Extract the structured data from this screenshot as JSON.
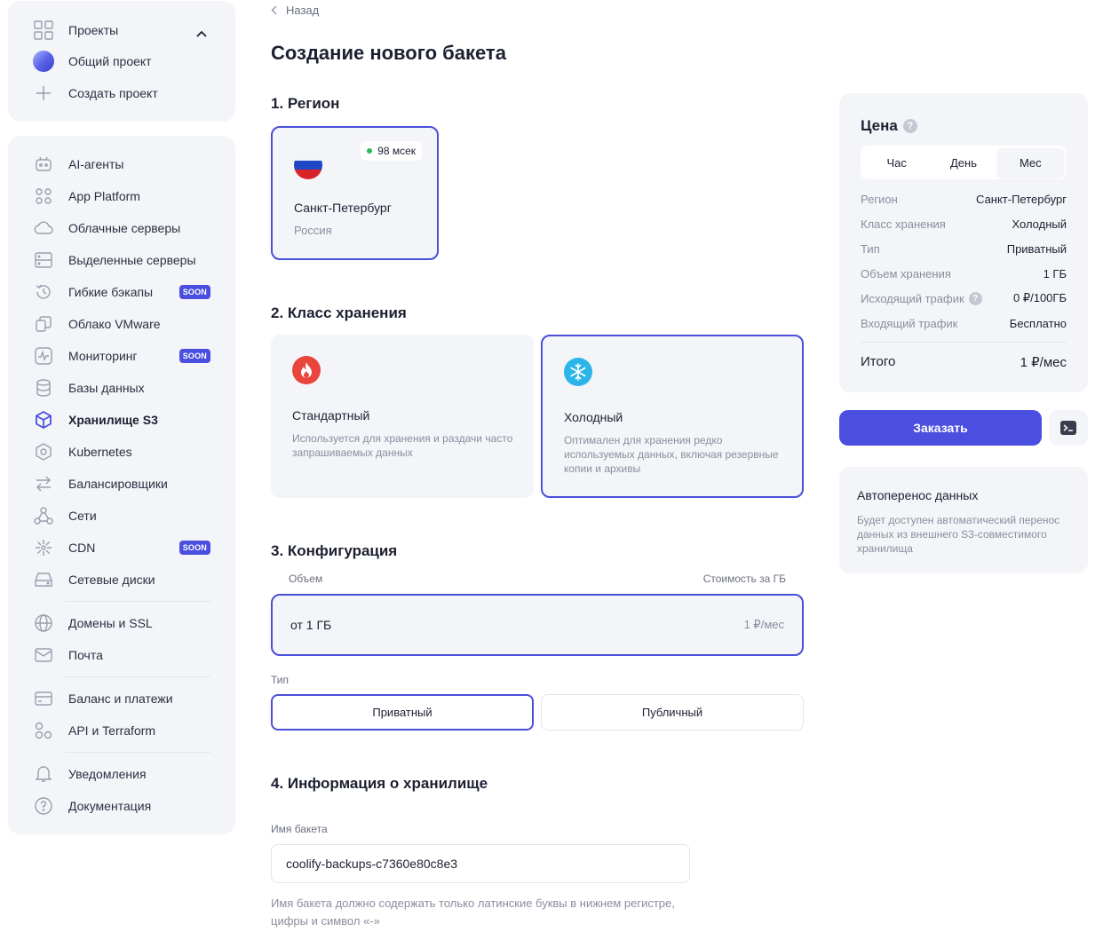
{
  "sidebar": {
    "projects": [
      {
        "label": "Проекты",
        "icon": "grid-icon"
      },
      {
        "label": "Общий проект",
        "icon": "project-avatar-icon"
      },
      {
        "label": "Создать проект",
        "icon": "plus-icon"
      }
    ],
    "items": [
      {
        "label": "AI-агенты",
        "icon": "robot-icon"
      },
      {
        "label": "App Platform",
        "icon": "apps-icon"
      },
      {
        "label": "Облачные серверы",
        "icon": "cloud-icon"
      },
      {
        "label": "Выделенные серверы",
        "icon": "server-icon"
      },
      {
        "label": "Гибкие бэкапы",
        "icon": "backup-icon",
        "badge": "SOON"
      },
      {
        "label": "Облако VMware",
        "icon": "vmware-icon"
      },
      {
        "label": "Мониторинг",
        "icon": "monitoring-icon",
        "badge": "SOON"
      },
      {
        "label": "Базы данных",
        "icon": "database-icon"
      },
      {
        "label": "Хранилище S3",
        "icon": "storage-cube-icon",
        "active": true
      },
      {
        "label": "Kubernetes",
        "icon": "kubernetes-icon"
      },
      {
        "label": "Балансировщики",
        "icon": "balancer-icon"
      },
      {
        "label": "Сети",
        "icon": "network-icon"
      },
      {
        "label": "CDN",
        "icon": "cdn-icon",
        "badge": "SOON"
      },
      {
        "label": "Сетевые диски",
        "icon": "disk-icon"
      },
      {
        "label": "Домены и SSL",
        "icon": "globe-icon"
      },
      {
        "label": "Почта",
        "icon": "mail-icon"
      },
      {
        "label": "Баланс и платежи",
        "icon": "card-icon"
      },
      {
        "label": "API и Terraform",
        "icon": "api-icon"
      },
      {
        "label": "Уведомления",
        "icon": "bell-icon"
      },
      {
        "label": "Документация",
        "icon": "help-icon"
      }
    ]
  },
  "main": {
    "back_label": "Назад",
    "title": "Создание нового бакета",
    "sections": {
      "region": "1. Регион",
      "storage_class": "2. Класс хранения",
      "configuration": "3. Конфигурация",
      "info": "4. Информация о хранилище"
    },
    "region": {
      "name": "Санкт-Петербург",
      "country": "Россия",
      "ping": "98 мсек"
    },
    "classes": [
      {
        "name": "Стандартный",
        "description": "Используется для хранения и раздачи часто запрашиваемых данных",
        "icon": "fire-icon",
        "color": "#e8453c"
      },
      {
        "name": "Холодный",
        "description": "Оптимален для хранения редко используемых данных, включая резервные копии и архивы",
        "icon": "snowflake-icon",
        "color": "#2cb5e8"
      }
    ],
    "config": {
      "volume_label": "Объем",
      "cost_label": "Стоимость за ГБ",
      "volume_value": "от 1 ГБ",
      "cost_value": "1 ₽/мес",
      "type_label": "Тип",
      "type_options": [
        "Приватный",
        "Публичный"
      ]
    },
    "bucket": {
      "name_label": "Имя бакета",
      "name_value": "coolify-backups-c7360e80c8e3",
      "hint": "Имя бакета должно содержать только латинские буквы в нижнем регистре, цифры и символ «-»"
    }
  },
  "price": {
    "title": "Цена",
    "periods": [
      "Час",
      "День",
      "Мес"
    ],
    "active_period": "Мес",
    "rows": [
      {
        "key": "Регион",
        "value": "Санкт-Петербург"
      },
      {
        "key": "Класс хранения",
        "value": "Холодный"
      },
      {
        "key": "Тип",
        "value": "Приватный"
      },
      {
        "key": "Объем хранения",
        "value": "1 ГБ"
      },
      {
        "key": "Исходящий трафик",
        "value": "0 ₽/100ГБ",
        "help": true
      },
      {
        "key": "Входящий трафик",
        "value": "Бесплатно"
      }
    ],
    "total_label": "Итого",
    "total_value": "1 ₽/мес",
    "order_label": "Заказать"
  },
  "transfer": {
    "title": "Автоперенос данных",
    "description": "Будет доступен автоматический перенос данных из внешнего S3-совместимого хранилища"
  },
  "colors": {
    "accent": "#4a4fe0",
    "panel": "#f4f5f8",
    "muted": "#8a8e9e"
  }
}
